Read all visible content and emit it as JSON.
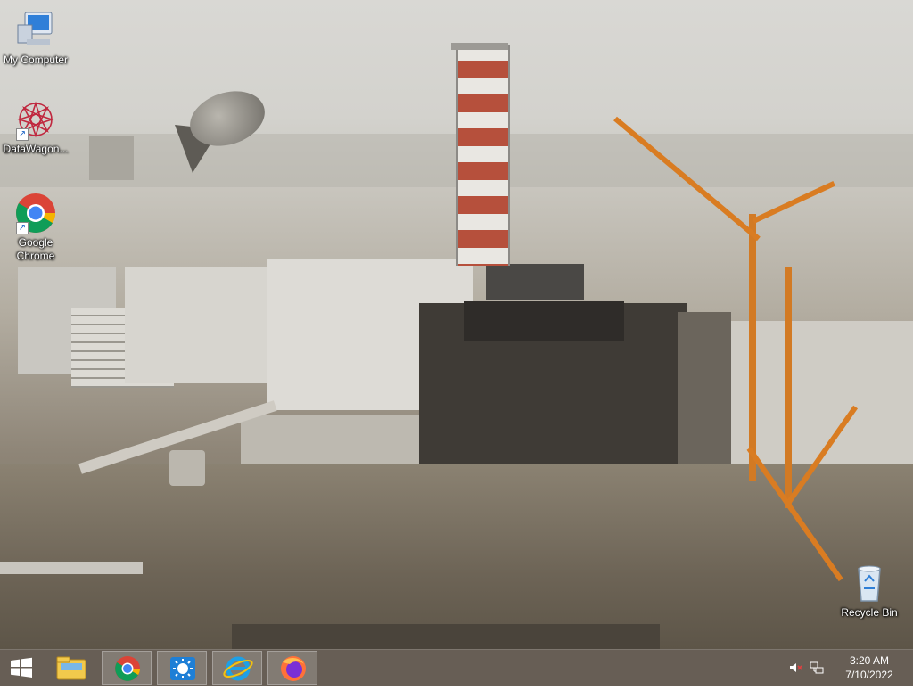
{
  "desktop": {
    "icons": [
      {
        "label": "My Computer",
        "icon": "computer-icon"
      },
      {
        "label": "DataWagon...",
        "icon": "datawagon-icon"
      },
      {
        "label": "Google Chrome",
        "icon": "chrome-icon"
      },
      {
        "label": "Recycle Bin",
        "icon": "recycle-bin-icon"
      }
    ]
  },
  "taskbar": {
    "start_icon": "windows-start-icon",
    "pinned": [
      {
        "icon": "file-explorer-icon"
      },
      {
        "icon": "chrome-icon"
      },
      {
        "icon": "control-panel-icon"
      },
      {
        "icon": "internet-explorer-icon"
      },
      {
        "icon": "firefox-icon"
      }
    ],
    "tray": {
      "volume_icon": "volume-muted-icon",
      "network_icon": "network-icon",
      "time": "3:20 AM",
      "date": "7/10/2022"
    }
  },
  "colors": {
    "taskbar_bg": "#463a30",
    "crane": "#d97c22",
    "stack_red": "#b6503c"
  }
}
